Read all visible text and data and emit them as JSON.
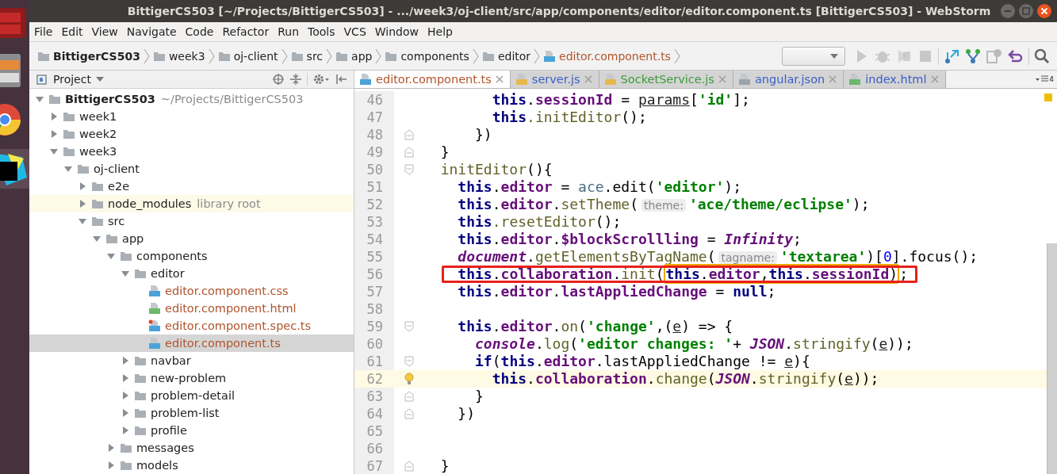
{
  "window": {
    "title": "BittigerCS503 [~/Projects/BittigerCS503] - .../week3/oj-client/src/app/components/editor/editor.component.ts [BittigerCS503] - WebStorm"
  },
  "menu": [
    "File",
    "Edit",
    "View",
    "Navigate",
    "Code",
    "Refactor",
    "Run",
    "Tools",
    "VCS",
    "Window",
    "Help"
  ],
  "breadcrumb": [
    {
      "label": "BittigerCS503",
      "kind": "root"
    },
    {
      "label": "week3",
      "kind": "folder"
    },
    {
      "label": "oj-client",
      "kind": "folder"
    },
    {
      "label": "src",
      "kind": "folder"
    },
    {
      "label": "app",
      "kind": "folder"
    },
    {
      "label": "components",
      "kind": "folder"
    },
    {
      "label": "editor",
      "kind": "folder"
    },
    {
      "label": "editor.component.ts",
      "kind": "ts"
    }
  ],
  "project_panel": {
    "title": "Project",
    "tree": [
      {
        "name": "BittigerCS503",
        "hint": "~/Projects/BittigerCS503",
        "kind": "root",
        "expanded": true,
        "selected": false,
        "children": [
          {
            "name": "week1",
            "kind": "folder",
            "expanded": false,
            "selected": false
          },
          {
            "name": "week2",
            "kind": "folder",
            "expanded": false,
            "selected": false
          },
          {
            "name": "week3",
            "kind": "folder",
            "expanded": true,
            "selected": false,
            "children": [
              {
                "name": "oj-client",
                "kind": "folder",
                "expanded": true,
                "selected": false,
                "children": [
                  {
                    "name": "e2e",
                    "kind": "folder",
                    "expanded": false,
                    "selected": false
                  },
                  {
                    "name": "node_modules",
                    "hint": "library root",
                    "kind": "library",
                    "expanded": false,
                    "selected": false
                  },
                  {
                    "name": "src",
                    "kind": "folder",
                    "expanded": true,
                    "selected": false,
                    "children": [
                      {
                        "name": "app",
                        "kind": "folder",
                        "expanded": true,
                        "selected": false,
                        "children": [
                          {
                            "name": "components",
                            "kind": "folder",
                            "expanded": true,
                            "selected": false,
                            "children": [
                              {
                                "name": "editor",
                                "kind": "folder",
                                "expanded": true,
                                "selected": false,
                                "children": [
                                  {
                                    "name": "editor.component.css",
                                    "kind": "css",
                                    "selected": false
                                  },
                                  {
                                    "name": "editor.component.html",
                                    "kind": "html",
                                    "selected": false
                                  },
                                  {
                                    "name": "editor.component.spec.ts",
                                    "kind": "spec",
                                    "selected": false
                                  },
                                  {
                                    "name": "editor.component.ts",
                                    "kind": "ts",
                                    "selected": true
                                  }
                                ]
                              },
                              {
                                "name": "navbar",
                                "kind": "folder",
                                "expanded": false,
                                "selected": false
                              },
                              {
                                "name": "new-problem",
                                "kind": "folder",
                                "expanded": false,
                                "selected": false
                              },
                              {
                                "name": "problem-detail",
                                "kind": "folder",
                                "expanded": false,
                                "selected": false
                              },
                              {
                                "name": "problem-list",
                                "kind": "folder",
                                "expanded": false,
                                "selected": false
                              },
                              {
                                "name": "profile",
                                "kind": "folder",
                                "expanded": false,
                                "selected": false
                              }
                            ]
                          },
                          {
                            "name": "messages",
                            "kind": "folder",
                            "expanded": false,
                            "selected": false
                          },
                          {
                            "name": "models",
                            "kind": "folder",
                            "expanded": false,
                            "selected": false
                          }
                        ]
                      }
                    ]
                  }
                ]
              }
            ]
          }
        ]
      }
    ]
  },
  "tabs": [
    {
      "label": "editor.component.ts",
      "kind": "ts",
      "color": "#b0552c",
      "selected": true
    },
    {
      "label": "server.js",
      "kind": "js",
      "color": "#3a5fc8",
      "selected": false
    },
    {
      "label": "SocketService.js",
      "kind": "js",
      "color": "#3c9a3c",
      "selected": false
    },
    {
      "label": "angular.json",
      "kind": "json",
      "color": "#3a5fc8",
      "selected": false
    },
    {
      "label": "index.html",
      "kind": "html",
      "color": "#3a5fc8",
      "selected": false
    }
  ],
  "tab_count": "4",
  "lines": [
    {
      "number": "46",
      "kind": "indent8",
      "current": false,
      "boxed": false,
      "tokens": [
        {
          "kind": "keyword",
          "text": "this"
        },
        {
          "kind": "plain",
          "text": "."
        },
        {
          "kind": "field",
          "text": "sessionId"
        },
        {
          "kind": "plain",
          "text": " = "
        },
        {
          "kind": "ref",
          "text": "params"
        },
        {
          "kind": "plain",
          "text": "["
        },
        {
          "kind": "string",
          "text": "'id'"
        },
        {
          "kind": "plain",
          "text": "];"
        }
      ]
    },
    {
      "number": "47",
      "kind": "indent8",
      "current": false,
      "boxed": false,
      "tokens": [
        {
          "kind": "keyword",
          "text": "this"
        },
        {
          "kind": "method",
          "text": ".initEditor"
        },
        {
          "kind": "plain",
          "text": "();"
        }
      ]
    },
    {
      "number": "48",
      "kind": "indent6",
      "current": false,
      "boxed": false,
      "gutter": {
        "kind": "fold_end"
      },
      "tokens": [
        {
          "kind": "plain",
          "text": "})"
        }
      ]
    },
    {
      "number": "49",
      "kind": "indent2",
      "current": false,
      "boxed": false,
      "gutter": {
        "kind": "fold_end"
      },
      "tokens": [
        {
          "kind": "plain",
          "text": "}"
        }
      ]
    },
    {
      "number": "50",
      "kind": "indent2",
      "current": false,
      "boxed": false,
      "gutter": {
        "kind": "fold_start"
      },
      "tokens": [
        {
          "kind": "method",
          "text": "initEditor"
        },
        {
          "kind": "plain",
          "text": "(){"
        }
      ]
    },
    {
      "number": "51",
      "kind": "indent4",
      "current": false,
      "boxed": false,
      "tokens": [
        {
          "kind": "keyword",
          "text": "this"
        },
        {
          "kind": "plain",
          "text": "."
        },
        {
          "kind": "field",
          "text": "editor"
        },
        {
          "kind": "plain",
          "text": " = "
        },
        {
          "kind": "ident",
          "text": "ace"
        },
        {
          "kind": "plain",
          "text": ".edit("
        },
        {
          "kind": "string",
          "text": "'editor'"
        },
        {
          "kind": "plain",
          "text": ");"
        }
      ]
    },
    {
      "number": "52",
      "kind": "indent4",
      "current": false,
      "boxed": false,
      "tokens": [
        {
          "kind": "keyword",
          "text": "this"
        },
        {
          "kind": "plain",
          "text": "."
        },
        {
          "kind": "field",
          "text": "editor"
        },
        {
          "kind": "plain",
          "text": "."
        },
        {
          "kind": "method",
          "text": "setTheme"
        },
        {
          "kind": "plain",
          "text": "("
        },
        {
          "kind": "hint",
          "text": "theme:"
        },
        {
          "kind": "string",
          "text": "'ace/theme/eclipse'"
        },
        {
          "kind": "plain",
          "text": ");"
        }
      ]
    },
    {
      "number": "53",
      "kind": "indent4",
      "current": false,
      "boxed": false,
      "tokens": [
        {
          "kind": "keyword",
          "text": "this"
        },
        {
          "kind": "method",
          "text": ".resetEditor"
        },
        {
          "kind": "plain",
          "text": "();"
        }
      ]
    },
    {
      "number": "54",
      "kind": "indent4",
      "current": false,
      "boxed": false,
      "tokens": [
        {
          "kind": "keyword",
          "text": "this"
        },
        {
          "kind": "plain",
          "text": "."
        },
        {
          "kind": "field",
          "text": "editor"
        },
        {
          "kind": "plain",
          "text": "."
        },
        {
          "kind": "field",
          "text": "$blockScrollling"
        },
        {
          "kind": "plain",
          "text": " = "
        },
        {
          "kind": "global",
          "text": "Infinity"
        },
        {
          "kind": "plain",
          "text": ";"
        }
      ]
    },
    {
      "number": "55",
      "kind": "indent4",
      "current": false,
      "boxed": false,
      "tokens": [
        {
          "kind": "global",
          "text": "document"
        },
        {
          "kind": "plain",
          "text": "."
        },
        {
          "kind": "method",
          "text": "getElementsByTagName"
        },
        {
          "kind": "plain",
          "text": "("
        },
        {
          "kind": "hint",
          "text": "tagname:"
        },
        {
          "kind": "string",
          "text": "'textarea'"
        },
        {
          "kind": "plain",
          "text": ")["
        },
        {
          "kind": "number",
          "text": "0"
        },
        {
          "kind": "plain",
          "text": "].focus();"
        }
      ]
    },
    {
      "number": "56",
      "kind": "indent4",
      "current": false,
      "boxed": true,
      "tokens": [
        {
          "kind": "keyword",
          "text": "this"
        },
        {
          "kind": "plain",
          "text": "."
        },
        {
          "kind": "field",
          "text": "collaboration"
        },
        {
          "kind": "plain",
          "text": "."
        },
        {
          "kind": "method",
          "text": "init"
        },
        {
          "kind": "plain",
          "text": "("
        },
        {
          "kind": "framed",
          "tokens": [
            {
              "kind": "keyword",
              "text": "this"
            },
            {
              "kind": "plain",
              "text": "."
            },
            {
              "kind": "field",
              "text": "editor"
            },
            {
              "kind": "plain",
              "text": ","
            },
            {
              "kind": "keyword",
              "text": "this"
            },
            {
              "kind": "plain",
              "text": "."
            },
            {
              "kind": "field",
              "text": "sessionId"
            },
            {
              "kind": "plain",
              "text": ")"
            }
          ]
        },
        {
          "kind": "plain",
          "text": ";"
        }
      ]
    },
    {
      "number": "57",
      "kind": "indent4",
      "current": false,
      "boxed": false,
      "tokens": [
        {
          "kind": "keyword",
          "text": "this"
        },
        {
          "kind": "plain",
          "text": "."
        },
        {
          "kind": "field",
          "text": "editor"
        },
        {
          "kind": "plain",
          "text": "."
        },
        {
          "kind": "field",
          "text": "lastAppliedChange"
        },
        {
          "kind": "plain",
          "text": " = "
        },
        {
          "kind": "keyword",
          "text": "null"
        },
        {
          "kind": "plain",
          "text": ";"
        }
      ]
    },
    {
      "number": "58",
      "current": false,
      "boxed": false
    },
    {
      "number": "59",
      "kind": "indent4",
      "current": false,
      "boxed": false,
      "gutter": {
        "kind": "fold_start"
      },
      "tokens": [
        {
          "kind": "keyword",
          "text": "this"
        },
        {
          "kind": "plain",
          "text": "."
        },
        {
          "kind": "field",
          "text": "editor"
        },
        {
          "kind": "plain",
          "text": "."
        },
        {
          "kind": "method",
          "text": "on"
        },
        {
          "kind": "plain",
          "text": "("
        },
        {
          "kind": "string",
          "text": "'change'"
        },
        {
          "kind": "plain",
          "text": ",("
        },
        {
          "kind": "ref",
          "text": "e"
        },
        {
          "kind": "plain",
          "text": ") => {"
        }
      ]
    },
    {
      "number": "60",
      "kind": "indent6",
      "current": false,
      "boxed": false,
      "tokens": [
        {
          "kind": "global",
          "text": "console"
        },
        {
          "kind": "plain",
          "text": "."
        },
        {
          "kind": "method",
          "text": "log"
        },
        {
          "kind": "plain",
          "text": "("
        },
        {
          "kind": "string",
          "text": "'editor changes: '"
        },
        {
          "kind": "plain",
          "text": "+ "
        },
        {
          "kind": "global",
          "text": "JSON"
        },
        {
          "kind": "plain",
          "text": "."
        },
        {
          "kind": "method",
          "text": "stringify"
        },
        {
          "kind": "plain",
          "text": "("
        },
        {
          "kind": "ref",
          "text": "e"
        },
        {
          "kind": "plain",
          "text": "));"
        }
      ]
    },
    {
      "number": "61",
      "kind": "indent6",
      "current": false,
      "boxed": false,
      "gutter": {
        "kind": "fold_start"
      },
      "tokens": [
        {
          "kind": "keyword",
          "text": "if"
        },
        {
          "kind": "plain",
          "text": "("
        },
        {
          "kind": "keyword",
          "text": "this"
        },
        {
          "kind": "plain",
          "text": "."
        },
        {
          "kind": "field",
          "text": "editor"
        },
        {
          "kind": "plain",
          "text": ".lastAppliedChange != "
        },
        {
          "kind": "ref",
          "text": "e"
        },
        {
          "kind": "plain",
          "text": "){"
        }
      ]
    },
    {
      "number": "62",
      "kind": "indent8",
      "current": true,
      "boxed": false,
      "gutter": {
        "kind": "bulb"
      },
      "tokens": [
        {
          "kind": "keyword",
          "text": "this"
        },
        {
          "kind": "plain",
          "text": "."
        },
        {
          "kind": "field",
          "text": "collaboration"
        },
        {
          "kind": "plain",
          "text": "."
        },
        {
          "kind": "method",
          "text": "change"
        },
        {
          "kind": "plain",
          "text": "("
        },
        {
          "kind": "global",
          "text": "JSON"
        },
        {
          "kind": "plain",
          "text": "."
        },
        {
          "kind": "method",
          "text": "stringify"
        },
        {
          "kind": "plain",
          "text": "("
        },
        {
          "kind": "ref",
          "text": "e"
        },
        {
          "kind": "plain",
          "text": "));"
        }
      ]
    },
    {
      "number": "63",
      "kind": "indent6",
      "current": false,
      "boxed": false,
      "gutter": {
        "kind": "fold_end"
      },
      "tokens": [
        {
          "kind": "plain",
          "text": "}"
        }
      ]
    },
    {
      "number": "64",
      "kind": "indent4",
      "current": false,
      "boxed": false,
      "gutter": {
        "kind": "fold_end"
      },
      "tokens": [
        {
          "kind": "plain",
          "text": "})"
        }
      ]
    },
    {
      "number": "65",
      "current": false,
      "boxed": false
    },
    {
      "number": "66",
      "current": false,
      "boxed": false
    },
    {
      "number": "67",
      "kind": "indent2",
      "current": false,
      "boxed": false,
      "gutter": {
        "kind": "fold_end"
      },
      "tokens": [
        {
          "kind": "plain",
          "text": "}"
        }
      ]
    }
  ]
}
